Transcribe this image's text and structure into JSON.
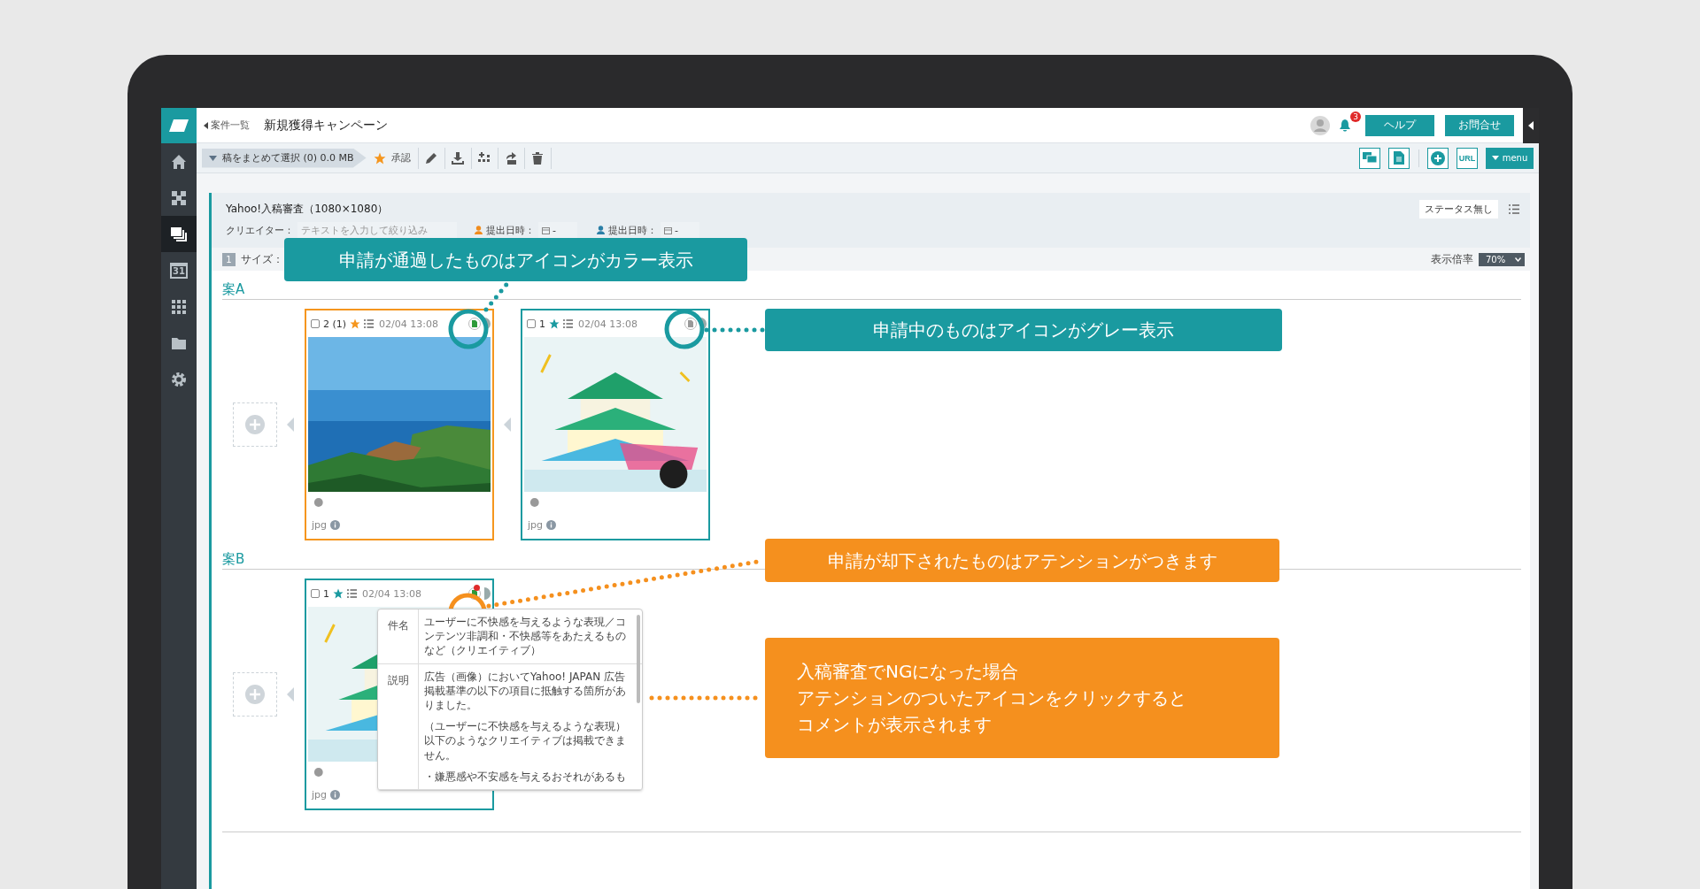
{
  "sidebar": {
    "items": [
      {
        "kind": "home",
        "selected": false
      },
      {
        "kind": "network",
        "selected": false
      },
      {
        "kind": "copies",
        "selected": true
      },
      {
        "kind": "calendar",
        "text": "31",
        "selected": false
      },
      {
        "kind": "apps",
        "selected": false
      },
      {
        "kind": "folder",
        "selected": false
      },
      {
        "kind": "settings",
        "selected": false
      }
    ]
  },
  "header": {
    "back_link": "案件一覧",
    "title": "新規獲得キャンペーン",
    "notification_count": "3",
    "buttons": [
      "ヘルプ",
      "お問合せ"
    ]
  },
  "toolbar": {
    "bulk_select": "稿をまとめて選択 (0) 0.0 MB",
    "approve": "承認",
    "right_tools": [
      {
        "kind": "chat"
      },
      {
        "kind": "document"
      },
      {
        "kind": "add"
      },
      {
        "kind": "url",
        "text": "URL"
      }
    ],
    "menu": "menu"
  },
  "panel": {
    "title": "Yahoo!入稿審査（1080×1080）",
    "status": "ステータス無し",
    "creator_label": "クリエイター：",
    "creator_placeholder": "テキストを入力して絞り込み",
    "date_filters": [
      {
        "label": "提出日時：",
        "value": "-",
        "color": "#f08c1e"
      },
      {
        "label": "提出日時：",
        "value": "-",
        "color": "#2a7ea6"
      }
    ],
    "size_number": "1",
    "size_label": "サイズ：",
    "zoom_label": "表示倍率",
    "zoom_value": "70%"
  },
  "groups": [
    {
      "title": "案A",
      "cards": [
        {
          "checked": false,
          "count": "2 (1)",
          "color": "#f5961e",
          "date": "02/04 13:08",
          "approved": true,
          "attention": false,
          "file_type": "jpg"
        },
        {
          "checked": false,
          "count": "1",
          "color": "#1a9aa0",
          "date": "02/04 13:08",
          "approved": false,
          "attention": false,
          "file_type": "jpg"
        }
      ]
    },
    {
      "title": "案B",
      "cards": [
        {
          "checked": false,
          "count": "1",
          "color": "#1a9aa0",
          "date": "02/04 13:08",
          "approved": true,
          "attention": true,
          "file_type": "jpg",
          "popup": {
            "rows": [
              {
                "label": "件名",
                "paragraphs": [
                  "ユーザーに不快感を与えるような表現／コンテンツ非調和・不快感等をあたえるものなど（クリエイティブ）"
                ]
              },
              {
                "label": "説明",
                "paragraphs": [
                  "広告（画像）においてYahoo! JAPAN 広告掲載基準の以下の項目に抵触する箇所がありました。",
                  "（ユーザーに不快感を与えるような表現）以下のようなクリエイティブは掲載できません。",
                  "・嫌悪感や不安感を与えるおそれがあるも"
                ]
              }
            ]
          }
        }
      ]
    }
  ],
  "callouts": [
    {
      "color": "#1a9aa0",
      "lines": [
        "申請が通過したものはアイコンがカラー表示"
      ]
    },
    {
      "color": "#1a9aa0",
      "lines": [
        "申請中のものはアイコンがグレー表示"
      ]
    },
    {
      "color": "#f5901e",
      "lines": [
        "申請が却下されたものはアテンションがつきます"
      ]
    },
    {
      "color": "#f5901e",
      "lines": [
        "入稿審査でNGになった場合",
        "アテンションのついたアイコンをクリックすると",
        "コメントが表示されます"
      ]
    }
  ]
}
